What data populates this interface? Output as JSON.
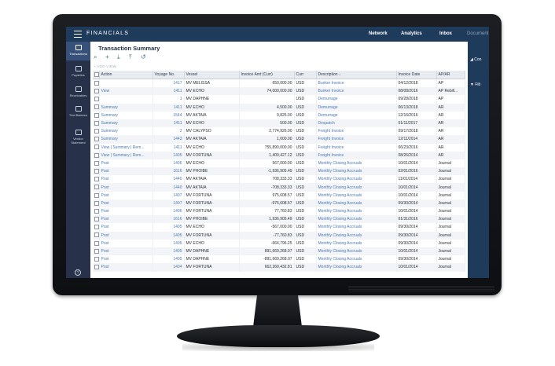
{
  "app": {
    "title": "FINANCIALS"
  },
  "topnav": {
    "items": [
      "Network",
      "Analytics",
      "Inbox",
      "Document"
    ]
  },
  "leftnav": {
    "items": [
      {
        "label": "Transactions",
        "icon": "transactions-icon",
        "active": true
      },
      {
        "label": "Payables",
        "icon": "payables-icon"
      },
      {
        "label": "Receivables",
        "icon": "receivables-icon"
      },
      {
        "label": "Trial Balance",
        "icon": "trial-balance-icon"
      },
      {
        "label": "Vendor Statement",
        "icon": "vendor-statement-icon"
      }
    ],
    "help": "?"
  },
  "page": {
    "title": "Transaction Summary",
    "add_view": "+ ADD VIEW"
  },
  "toolbar": {
    "icons": [
      "search-icon",
      "add-icon",
      "download-icon",
      "upload-icon",
      "refresh-icon"
    ]
  },
  "right_panel": {
    "items": [
      "Con",
      "Filt"
    ]
  },
  "table": {
    "columns": [
      "Action",
      "Voyage No.",
      "Vessel",
      "Invoice Amt (Curr)",
      "Curr",
      "Description ↓",
      "Invoice Date",
      "AP/AR"
    ],
    "rows": [
      [
        "",
        "1417",
        "MV MELISSA",
        "650,000.00",
        "USD",
        "Bunker Invoice",
        "04/12/2018",
        "AP"
      ],
      [
        "View",
        "1411",
        "MV ECHO",
        "74,000,000.00",
        "USD",
        "Bunker Invoice",
        "08/08/2016",
        "AP Rebill..."
      ],
      [
        "",
        "1",
        "MV DAPHNE",
        "",
        "USD",
        "Demurrage",
        "09/28/2018",
        "AP"
      ],
      [
        "Summary",
        "1411",
        "MV ECHO",
        "4,500.00",
        "USD",
        "Demurrage",
        "06/13/2018",
        "AR"
      ],
      [
        "Summary",
        "1544",
        "MV AKTAIA",
        "9,825.00",
        "USD",
        "Demurrage",
        "12/16/2016",
        "AR"
      ],
      [
        "Summary",
        "1411",
        "MV ECHO",
        "500.00",
        "USD",
        "Despatch",
        "01/11/2017",
        "AR"
      ],
      [
        "Summary",
        "2",
        "MV CALYPSO",
        "2,774,926.00",
        "USD",
        "Freight Invoice",
        "09/17/2018",
        "AR"
      ],
      [
        "Summary",
        "1443",
        "MV AKTAIA",
        "1,000.00",
        "USD",
        "Freight Invoice",
        "12/11/2014",
        "AR"
      ],
      [
        "View | Summary | Rem...",
        "1411",
        "MV ECHO",
        "755,890,000.00",
        "USD",
        "Freight Invoice",
        "06/23/2016",
        "AR"
      ],
      [
        "View | Summary | Rem...",
        "1405",
        "MV FORTUNA",
        "1,409,427.12",
        "USD",
        "Freight Invoice",
        "08/26/2014",
        "AR"
      ],
      [
        "Post",
        "1406",
        "MV ECHO",
        "567,000.00",
        "USD",
        "Monthly Closing Accruals",
        "10/01/2014",
        "Journal"
      ],
      [
        "Post",
        "1616",
        "MV PHOIBE",
        "-1,936,905.49",
        "USD",
        "Monthly Closing Accruals",
        "02/01/2016",
        "Journal"
      ],
      [
        "Post",
        "1440",
        "MV AKTAIA",
        "708,333.33",
        "USD",
        "Monthly Closing Accruals",
        "11/01/2014",
        "Journal"
      ],
      [
        "Post",
        "1440",
        "MV AKTAIA",
        "-708,333.33",
        "USD",
        "Monthly Closing Accruals",
        "10/01/2014",
        "Journal"
      ],
      [
        "Post",
        "1407",
        "MV FORTUNA",
        "975,608.57",
        "USD",
        "Monthly Closing Accruals",
        "10/01/2014",
        "Journal"
      ],
      [
        "Post",
        "1407",
        "MV FORTUNA",
        "-975,608.57",
        "USD",
        "Monthly Closing Accruals",
        "09/30/2014",
        "Journal"
      ],
      [
        "Post",
        "1406",
        "MV FORTUNA",
        "77,760.83",
        "USD",
        "Monthly Closing Accruals",
        "10/01/2014",
        "Journal"
      ],
      [
        "Post",
        "1616",
        "MV PHOIBE",
        "1,936,905.49",
        "USD",
        "Monthly Closing Accruals",
        "01/31/2016",
        "Journal"
      ],
      [
        "Post",
        "1405",
        "MV ECHO",
        "-567,000.00",
        "USD",
        "Monthly Closing Accruals",
        "09/30/2014",
        "Journal"
      ],
      [
        "Post",
        "1405",
        "MV FORTUNA",
        "-77,760.83",
        "USD",
        "Monthly Closing Accruals",
        "09/30/2014",
        "Journal"
      ],
      [
        "Post",
        "1405",
        "MV ECHO",
        "-664,796.25",
        "USD",
        "Monthly Closing Accruals",
        "09/30/2014",
        "Journal"
      ],
      [
        "Post",
        "1405",
        "MV DAPHNE",
        "891,669,268.07",
        "USD",
        "Monthly Closing Accruals",
        "10/01/2014",
        "Journal"
      ],
      [
        "Post",
        "1405",
        "MV DAPHNE",
        "-891,669,268.07",
        "USD",
        "Monthly Closing Accruals",
        "09/30/2014",
        "Journal"
      ],
      [
        "Post",
        "1404",
        "MV FORTUNA",
        "662,260,432.81",
        "USD",
        "Monthly Closing Accruals",
        "10/01/2014",
        "Journal"
      ]
    ]
  },
  "colors": {
    "topbar": "#1f3b5c",
    "leftnav": "#27324a",
    "link": "#4b79b3"
  }
}
